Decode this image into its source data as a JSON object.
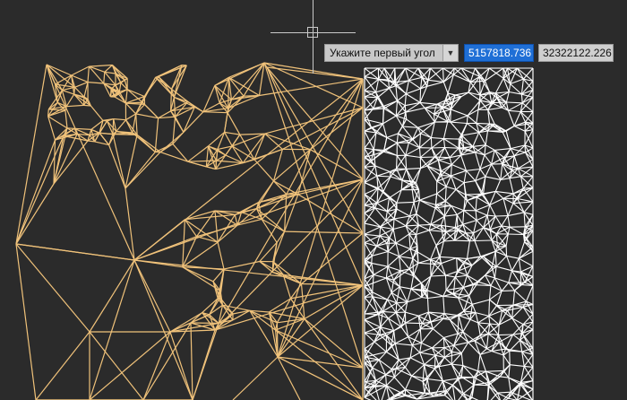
{
  "drawing": {
    "colors": {
      "background": "#2b2b2b",
      "left_mesh": "#f0c27a",
      "right_mesh": "#ffffff",
      "crosshair": "#c9c9c9"
    }
  },
  "dynamic_input": {
    "prompt": "Укажите первый угол",
    "dropdown_icon": "chevron-down-icon",
    "x_value": "5157818.736",
    "y_value": "32322122.226"
  }
}
